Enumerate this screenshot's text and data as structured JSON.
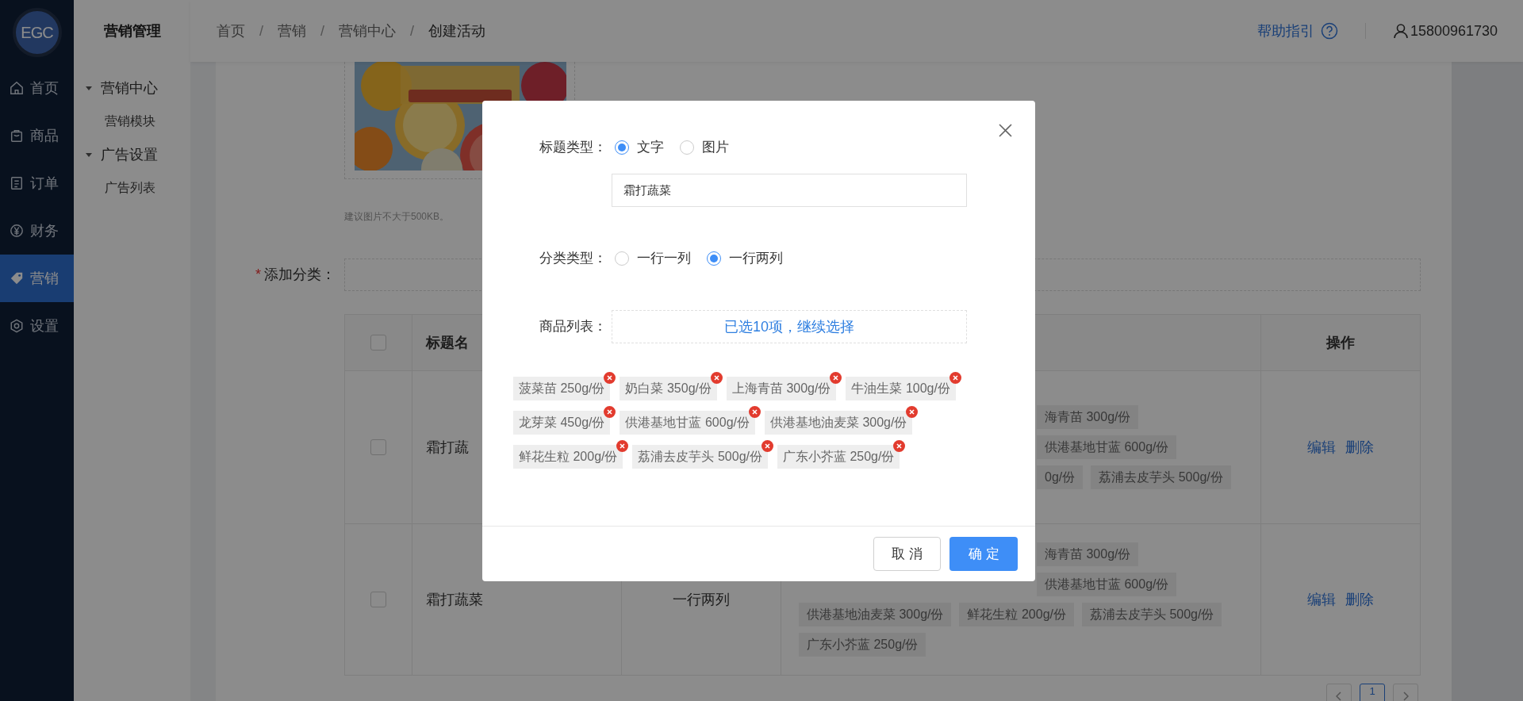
{
  "sidebar": {
    "logo": "EGC",
    "items": [
      {
        "label": "首页",
        "selected": false
      },
      {
        "label": "商品",
        "selected": false
      },
      {
        "label": "订单",
        "selected": false
      },
      {
        "label": "财务",
        "selected": false
      },
      {
        "label": "营销",
        "selected": true
      },
      {
        "label": "设置",
        "selected": false
      }
    ]
  },
  "submenu": {
    "title": "营销管理",
    "groups": [
      {
        "label": "营销中心",
        "expanded": true,
        "children": [
          {
            "label": "营销模块"
          }
        ]
      },
      {
        "label": "广告设置",
        "expanded": true,
        "children": [
          {
            "label": "广告列表"
          }
        ]
      }
    ]
  },
  "header": {
    "breadcrumb": [
      {
        "kind": "link",
        "label": "首页"
      },
      {
        "kind": "separator",
        "label": "/"
      },
      {
        "kind": "link",
        "label": "营销"
      },
      {
        "kind": "separator",
        "label": "/"
      },
      {
        "kind": "link",
        "label": "营销中心"
      },
      {
        "kind": "separator",
        "label": "/"
      },
      {
        "kind": "current",
        "label": "创建活动"
      }
    ],
    "help": "帮助指引",
    "user": "15800961730"
  },
  "form": {
    "image_hint": "建议图片不大于500KB。",
    "category_label": "添加分类：",
    "required_mark": "*"
  },
  "table": {
    "all_checked": false,
    "columns": [
      "标题名",
      "操作"
    ],
    "rows": [
      {
        "checked": false,
        "title": "霜打蔬",
        "tag_lines": [
          [
            "海青苗 300g/份"
          ],
          [
            "供港基地甘蓝 600g/份"
          ],
          [
            "0g/份",
            "荔浦去皮芋头 500g/份"
          ]
        ],
        "actions": [
          "编辑",
          "删除"
        ]
      },
      {
        "checked": false,
        "title": "霜打蔬菜",
        "type": "一行两列",
        "tag_lines": [
          [
            "海青苗 300g/份"
          ],
          [
            "供港基地甘蓝 600g/份"
          ],
          [
            "供港基地油麦菜 300g/份",
            "鲜花生粒 200g/份",
            "荔浦去皮芋头 500g/份"
          ],
          [
            "广东小芥蓝 250g/份"
          ]
        ],
        "actions": [
          "编辑",
          "删除"
        ]
      }
    ]
  },
  "pagination": {
    "pages": [
      {
        "label": "1",
        "selected": true
      }
    ]
  },
  "modal": {
    "title_type": {
      "label": "标题类型：",
      "options": [
        {
          "label": "文字",
          "selected": true
        },
        {
          "label": "图片",
          "selected": false
        }
      ]
    },
    "title_input": {
      "value": "霜打蔬菜"
    },
    "category_type": {
      "label": "分类类型：",
      "options": [
        {
          "label": "一行一列",
          "selected": false
        },
        {
          "label": "一行两列",
          "selected": true
        }
      ]
    },
    "goods": {
      "label": "商品列表：",
      "picker": "已选10项，继续选择",
      "selected_items": [
        "菠菜苗 250g/份",
        "奶白菜 350g/份",
        "上海青苗 300g/份",
        "牛油生菜 100g/份",
        "龙芽菜 450g/份",
        "供港基地甘蓝 600g/份",
        "供港基地油麦菜 300g/份",
        "鲜花生粒 200g/份",
        "荔浦去皮芋头 500g/份",
        "广东小芥蓝 250g/份"
      ]
    },
    "buttons": {
      "cancel": "取消",
      "ok": "确定"
    }
  }
}
